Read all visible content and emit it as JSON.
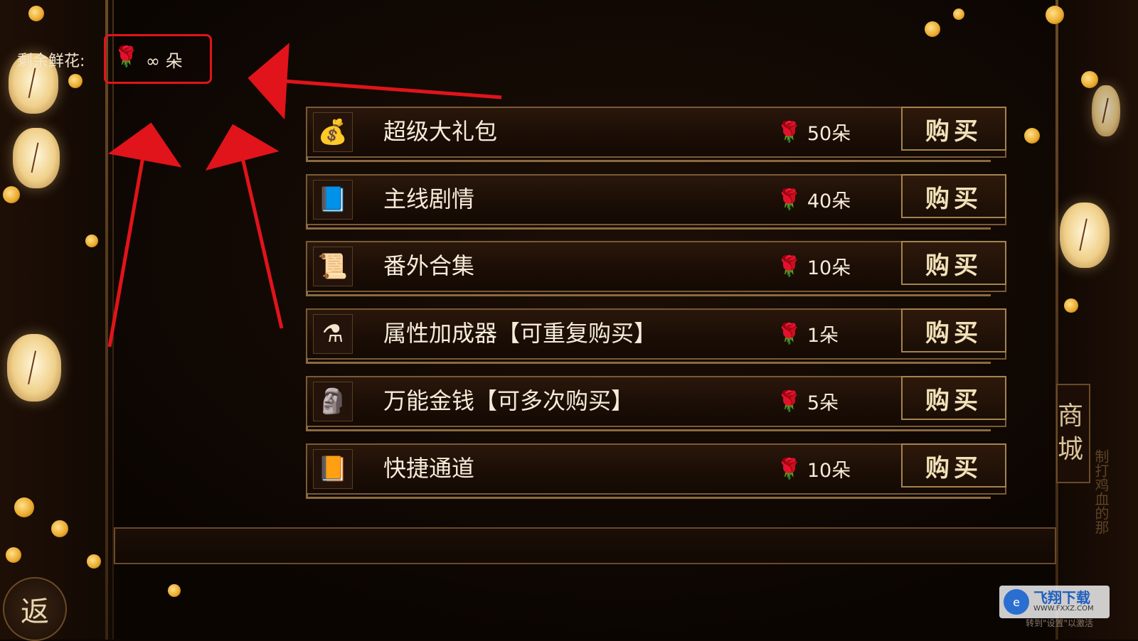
{
  "header": {
    "flowers_label": "剩余鲜花:",
    "flowers_value": "∞ 朵",
    "rose_icon": "rose-icon"
  },
  "shop": {
    "buy_label": "购买",
    "items": [
      {
        "name": "超级大礼包",
        "price": "50朵",
        "icon": "money-bag-icon",
        "glyph": "💰"
      },
      {
        "name": "主线剧情",
        "price": "40朵",
        "icon": "book-icon",
        "glyph": "📘"
      },
      {
        "name": "番外合集",
        "price": "10朵",
        "icon": "scroll-icon",
        "glyph": "📜"
      },
      {
        "name": "属性加成器【可重复购买】",
        "price": "1朵",
        "icon": "potion-icon",
        "glyph": "⚗"
      },
      {
        "name": "万能金钱【可多次购买】",
        "price": "5朵",
        "icon": "golden-statue-icon",
        "glyph": "🗿"
      },
      {
        "name": "快捷通道",
        "price": "10朵",
        "icon": "gate-icon",
        "glyph": "📙"
      }
    ]
  },
  "nav": {
    "back_label": "返",
    "shop_tab_label": "商城",
    "side_text": "制打鸡血的那"
  },
  "watermark": {
    "title": "飞翔下载",
    "url": "WWW.FXXZ.COM",
    "activate_text": "转到\"设置\"以激活"
  },
  "colors": {
    "annotation_red": "#e0141a",
    "gold_border": "#a5834f",
    "background": "#0d0602"
  }
}
